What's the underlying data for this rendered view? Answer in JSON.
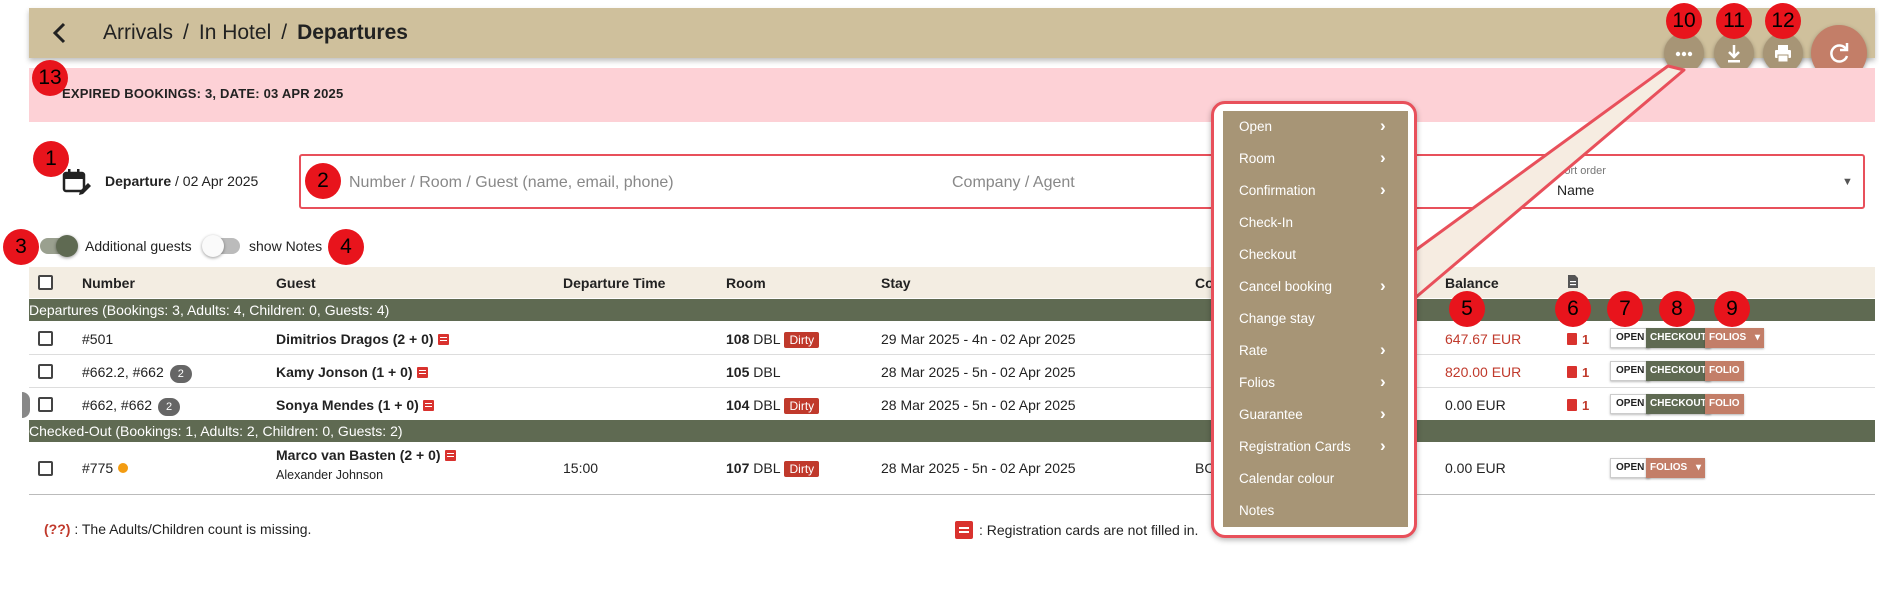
{
  "header": {
    "breadcrumb": [
      "Arrivals",
      "In Hotel",
      "Departures"
    ],
    "separator": "/",
    "back_icon": "chevron-left-icon",
    "bg_color": "#cfc09c"
  },
  "actions": {
    "more_icon": "more-horizontal-icon",
    "download_icon": "download-icon",
    "print_icon": "print-icon",
    "refresh_icon": "refresh-icon"
  },
  "alert": {
    "text": "EXPIRED BOOKINGS: 3, DATE: 03 APR 2025",
    "bg_color": "#fdd1d6"
  },
  "filters": {
    "date_type": "Departure",
    "date_value": "/ 02 Apr 2025",
    "search_placeholder": "Number / Room / Guest (name, email, phone)",
    "company_placeholder": "Company / Agent",
    "sort_label": "Sort order",
    "sort_value": "Name"
  },
  "toggles": {
    "additional_guests": "Additional guests",
    "additional_guests_on": true,
    "show_notes": "show Notes",
    "show_notes_on": false
  },
  "table": {
    "columns": {
      "number": "Number",
      "guest": "Guest",
      "departure_time": "Departure Time",
      "room": "Room",
      "stay": "Stay",
      "company": "Co",
      "balance": "Balance"
    },
    "groups": [
      "Departures (Bookings: 3, Adults: 4, Children: 0, Guests: 4)",
      "Checked-Out (Bookings: 1, Adults: 2, Children: 0, Guests: 2)"
    ],
    "rows": [
      {
        "number": "#501",
        "badge": "",
        "guest": "Dimitrios Dragos (2 + 0)",
        "room_no": "108",
        "room_type": "DBL",
        "dirty": "Dirty",
        "stay": "29 Mar 2025 - 4n - 02 Apr 2025",
        "balance": "647.67 EUR",
        "docs": "1",
        "open": "OPEN",
        "checkout": "CHECKOUT",
        "folio": "FOLIOS"
      },
      {
        "number": "#662.2, #662",
        "badge": "2",
        "guest": "Kamy Jonson (1 + 0)",
        "room_no": "105",
        "room_type": "DBL",
        "dirty": "",
        "stay": "28 Mar 2025 - 5n - 02 Apr 2025",
        "balance": "820.00 EUR",
        "docs": "1",
        "open": "OPEN",
        "checkout": "CHECKOUT",
        "folio": "FOLIO"
      },
      {
        "number": "#662, #662",
        "badge": "2",
        "guest": "Sonya Mendes (1 + 0)",
        "room_no": "104",
        "room_type": "DBL",
        "dirty": "Dirty",
        "stay": "28 Mar 2025 - 5n - 02 Apr 2025",
        "balance": "0.00 EUR",
        "docs": "1",
        "open": "OPEN",
        "checkout": "CHECKOUT",
        "folio": "FOLIO"
      },
      {
        "number": "#775",
        "guest": "Marco van Basten (2 + 0)",
        "guest2": "Alexander Johnson",
        "departure_time": "15:00",
        "room_no": "107",
        "room_type": "DBL",
        "dirty": "Dirty",
        "stay": "28 Mar 2025 - 5n - 02 Apr 2025",
        "company": "BC",
        "balance": "0.00 EUR",
        "open": "OPEN",
        "folio": "FOLIOS"
      }
    ]
  },
  "legend": {
    "missing_marker": "(??)",
    "missing_text": ": The Adults/Children count is missing.",
    "reg_text": ": Registration cards are not filled in."
  },
  "context_menu": {
    "items": [
      {
        "label": "Open",
        "submenu": true
      },
      {
        "label": "Room",
        "submenu": true
      },
      {
        "label": "Confirmation",
        "submenu": true
      },
      {
        "label": "Check-In",
        "submenu": false
      },
      {
        "label": "Checkout",
        "submenu": false
      },
      {
        "label": "Cancel booking",
        "submenu": true
      },
      {
        "label": "Change stay",
        "submenu": false
      },
      {
        "label": "Rate",
        "submenu": true
      },
      {
        "label": "Folios",
        "submenu": true
      },
      {
        "label": "Guarantee",
        "submenu": true
      },
      {
        "label": "Registration Cards",
        "submenu": true
      },
      {
        "label": "Calendar colour",
        "submenu": false
      },
      {
        "label": "Notes",
        "submenu": false
      }
    ],
    "bg_color": "#a79576"
  },
  "markers": [
    "1",
    "2",
    "3",
    "4",
    "5",
    "6",
    "7",
    "8",
    "9",
    "10",
    "11",
    "12",
    "13"
  ],
  "colors": {
    "group_row": "#5f6a52",
    "folio": "#c37e68",
    "marker": "#e8141c",
    "dirty": "#c0392b"
  }
}
